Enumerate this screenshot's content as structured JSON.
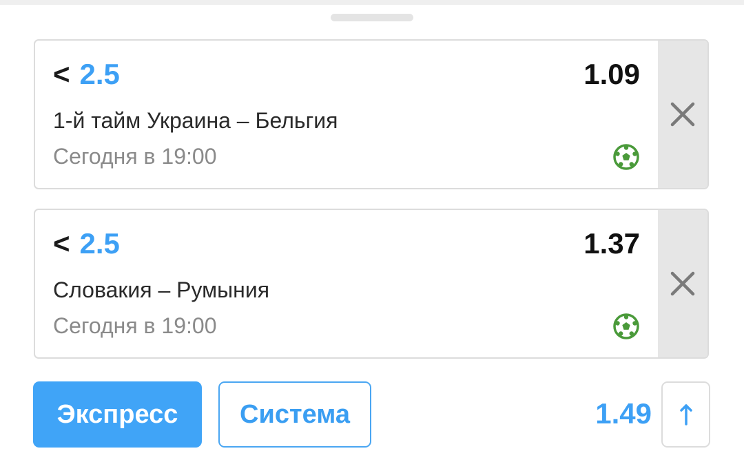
{
  "coupon": {
    "bets": [
      {
        "sign": "<",
        "line": "2.5",
        "odds": "1.09",
        "event": "1-й тайм Украина – Бельгия",
        "time": "Сегодня в 19:00",
        "sport_icon": "soccer-ball-icon",
        "remove_icon": "close-icon"
      },
      {
        "sign": "<",
        "line": "2.5",
        "odds": "1.37",
        "event": "Словакия – Румыния",
        "time": "Сегодня в 19:00",
        "sport_icon": "soccer-ball-icon",
        "remove_icon": "close-icon"
      }
    ]
  },
  "footer": {
    "express_label": "Экспресс",
    "system_label": "Система",
    "total_odds": "1.49",
    "expand_icon": "arrow-up-icon"
  },
  "colors": {
    "accent": "#3da0f5",
    "express_bg": "#40a4f7",
    "soccer_icon": "#4a9a3a",
    "remove_bg": "#e6e6e6"
  }
}
